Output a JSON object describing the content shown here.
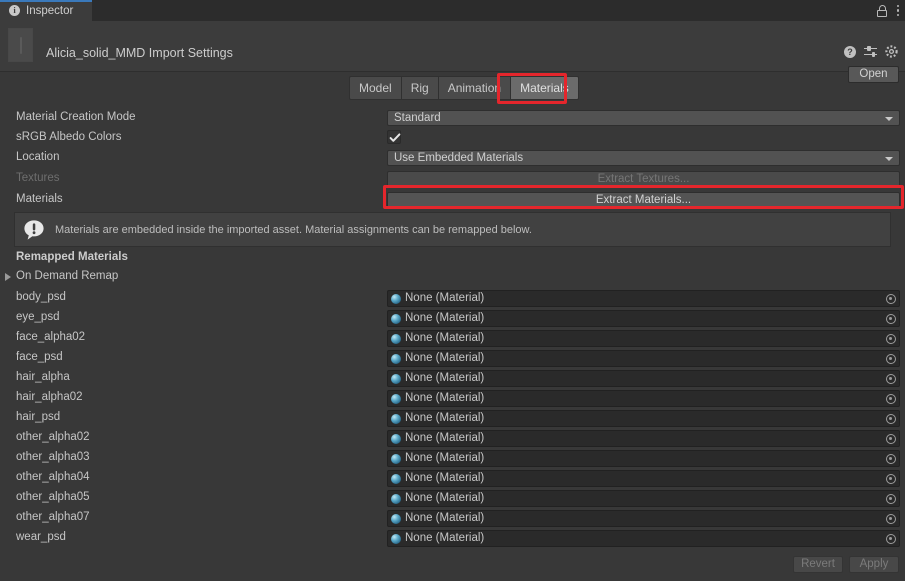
{
  "window": {
    "tab_label": "Inspector",
    "tab_icon": "info-icon",
    "lock_icon": "lock-icon",
    "menu_icon": "kebab-menu-icon"
  },
  "header": {
    "asset_title": "Alicia_solid_MMD Import Settings",
    "thumbnail_icon": "asset-preview-thumbnail",
    "help_icon": "help-icon",
    "preset_icon": "preset-icon",
    "settings_icon": "gear-icon",
    "open_label": "Open"
  },
  "tabs": [
    {
      "label": "Model",
      "active": false
    },
    {
      "label": "Rig",
      "active": false
    },
    {
      "label": "Animation",
      "active": false
    },
    {
      "label": "Materials",
      "active": true
    }
  ],
  "properties": {
    "material_creation_mode": {
      "label": "Material Creation Mode",
      "value": "Standard"
    },
    "srgb_albedo_colors": {
      "label": "sRGB Albedo Colors",
      "checked": true
    },
    "location": {
      "label": "Location",
      "value": "Use Embedded Materials"
    },
    "textures": {
      "label": "Textures",
      "button_label": "Extract Textures...",
      "disabled": true
    },
    "materials": {
      "label": "Materials",
      "button_label": "Extract Materials...",
      "disabled": false
    }
  },
  "helpbox": {
    "icon": "warning-info-icon",
    "text": "Materials are embedded inside the imported asset. Material assignments can be remapped below."
  },
  "remapped": {
    "section_title": "Remapped Materials",
    "on_demand_remap_label": "On Demand Remap",
    "foldout_icon": "chevron-right-icon",
    "object_placeholder": "None (Material)",
    "object_icon": "material-sphere-icon",
    "picker_icon": "object-picker-icon",
    "rows": [
      {
        "name": "body_psd",
        "value": "None (Material)"
      },
      {
        "name": "eye_psd",
        "value": "None (Material)"
      },
      {
        "name": "face_alpha02",
        "value": "None (Material)"
      },
      {
        "name": "face_psd",
        "value": "None (Material)"
      },
      {
        "name": "hair_alpha",
        "value": "None (Material)"
      },
      {
        "name": "hair_alpha02",
        "value": "None (Material)"
      },
      {
        "name": "hair_psd",
        "value": "None (Material)"
      },
      {
        "name": "other_alpha02",
        "value": "None (Material)"
      },
      {
        "name": "other_alpha03",
        "value": "None (Material)"
      },
      {
        "name": "other_alpha04",
        "value": "None (Material)"
      },
      {
        "name": "other_alpha05",
        "value": "None (Material)"
      },
      {
        "name": "other_alpha07",
        "value": "None (Material)"
      },
      {
        "name": "wear_psd",
        "value": "None (Material)"
      }
    ]
  },
  "footer": {
    "revert_label": "Revert",
    "apply_label": "Apply",
    "disabled": true
  },
  "annotations": {
    "highlight_color": "#e5262c",
    "boxes": [
      "materials-tab",
      "extract-materials-button"
    ]
  },
  "colors": {
    "window_bg": "#383838",
    "panel_bg": "#3c3c3c",
    "tabstrip_bg": "#2c2c2c",
    "accent_blue": "#3a79bb",
    "field_bg": "#2a2a2a",
    "button_bg": "#545454",
    "text": "#c6c6c6",
    "text_disabled": "#6e6e6e"
  }
}
